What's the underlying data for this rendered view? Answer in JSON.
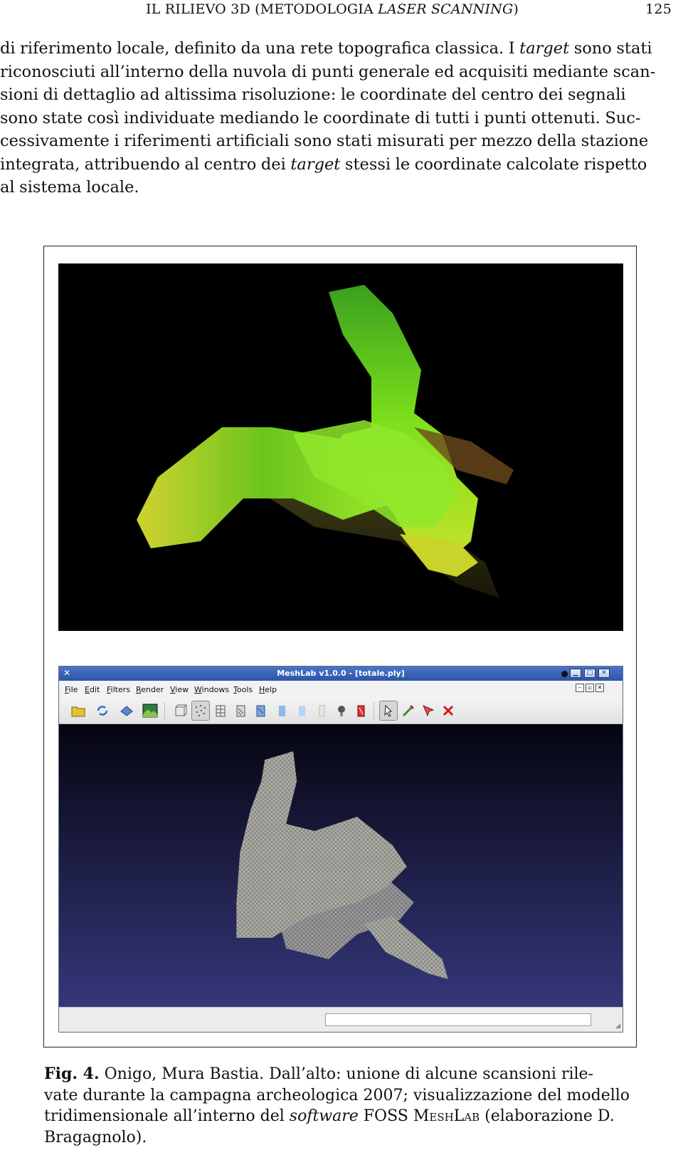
{
  "running_head": {
    "title_pre": "IL RILIEVO 3D (METODOLOGIA ",
    "title_italic": "LASER SCANNING",
    "title_post": ")",
    "page_number": "125"
  },
  "paragraph": {
    "l1_pre": "di riferimento locale, definito da una rete topografica classica. I ",
    "l1_it": "target",
    "l1_post": " sono stati",
    "l2": "riconosciuti all’interno della nuvola di punti generale ed acquisiti mediante scan-",
    "l3": "sioni di dettaglio ad altissima risoluzione:  le coordinate del centro dei segnali",
    "l4": "sono state così individuate mediando le coordinate di tutti i punti ottenuti. Suc-",
    "l5": "cessivamente i riferimenti artificiali sono stati misurati per mezzo della stazione",
    "l6_pre": "integrata, attribuendo al centro dei ",
    "l6_it": "target",
    "l6_post": " stessi le coordinate calcolate rispetto",
    "l7": "al sistema locale."
  },
  "meshlab": {
    "window_title": "MeshLab v1.0.0 - [totale.ply]",
    "menus": [
      "File",
      "Edit",
      "Filters",
      "Render",
      "View",
      "Windows",
      "Tools",
      "Help"
    ],
    "toolbar_icons": [
      "open-folder-icon",
      "reload-icon",
      "save-icon",
      "snapshot-icon",
      "bbox-icon",
      "points-icon",
      "wireframe-icon",
      "hidden-lines-icon",
      "flat-lines-icon",
      "flat-icon",
      "smooth-icon",
      "texture-icon",
      "light-icon",
      "color-icon",
      "select-icon",
      "measure-icon",
      "pick-icon",
      "delete-icon"
    ]
  },
  "caption": {
    "label": "Fig.  4.",
    "l1_text": " Onigo, Mura Bastia.  Dall’alto:  unione di alcune scansioni rile-",
    "l2": "vate durante la campagna archeologica 2007;  visualizzazione del modello",
    "l3_pre": "tridimensionale all’interno del ",
    "l3_it": "software",
    "l3_mid": " FOSS ",
    "l3_sc": "MeshLab",
    "l3_post": " (elaborazione D.",
    "l4": "Bragagnolo)."
  }
}
